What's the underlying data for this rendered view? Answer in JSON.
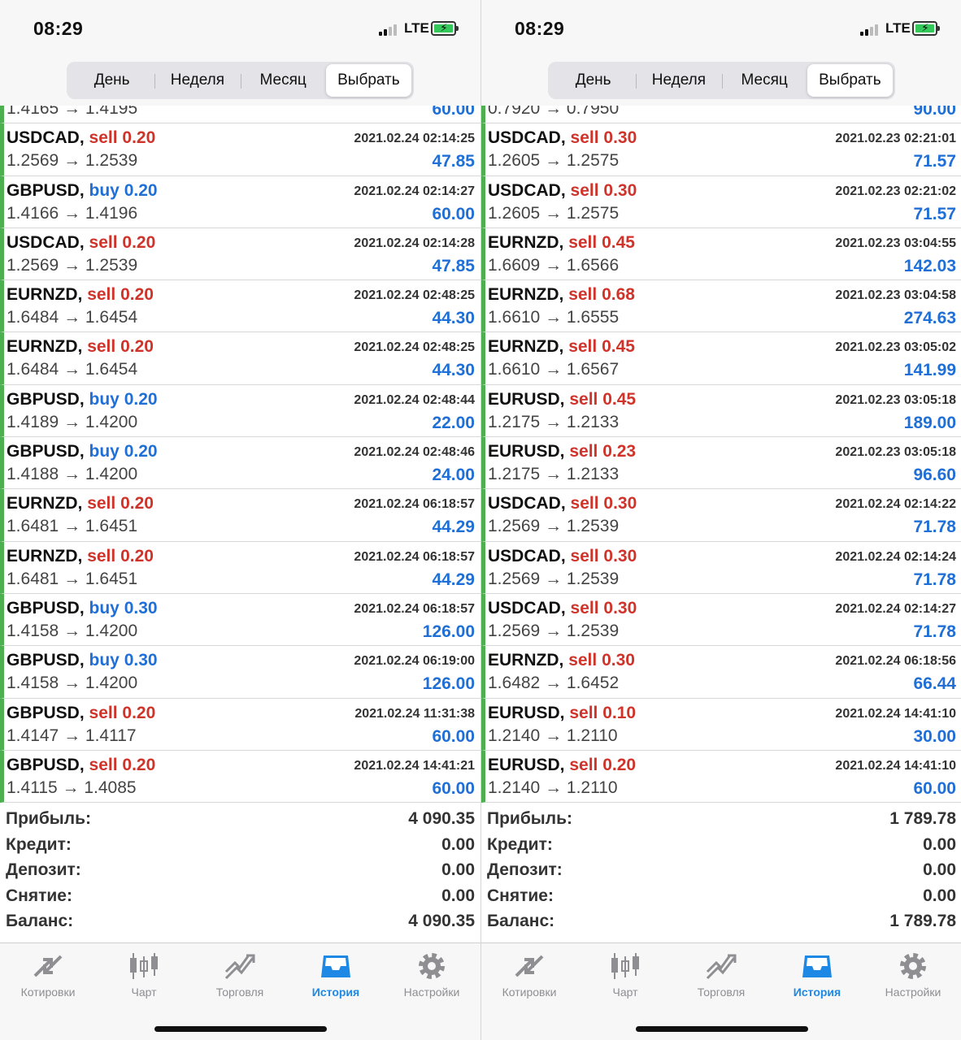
{
  "status_bar": {
    "time": "08:29",
    "network": "LTE"
  },
  "segments": [
    "День",
    "Неделя",
    "Месяц",
    "Выбрать"
  ],
  "active_segment": "Выбрать",
  "tabs": [
    "Котировки",
    "Чарт",
    "Торговля",
    "История",
    "Настройки"
  ],
  "active_tab": "История",
  "colors": {
    "sell": "#d0332a",
    "buy": "#1f6fd6",
    "profit": "#1f6fd6",
    "accent_tab": "#1e88e5",
    "closed_marker": "#4caf50"
  },
  "panels": [
    {
      "clipped_row": {
        "prices": "1.4165 → 1.4195",
        "profit": "60.00"
      },
      "trades": [
        {
          "symbol": "USDCAD,",
          "side": "sell",
          "volume": "0.20",
          "datetime": "2021.02.24 02:14:25",
          "prices": "1.2569 → 1.2539",
          "profit": "47.85"
        },
        {
          "symbol": "GBPUSD,",
          "side": "buy",
          "volume": "0.20",
          "datetime": "2021.02.24 02:14:27",
          "prices": "1.4166 → 1.4196",
          "profit": "60.00"
        },
        {
          "symbol": "USDCAD,",
          "side": "sell",
          "volume": "0.20",
          "datetime": "2021.02.24 02:14:28",
          "prices": "1.2569 → 1.2539",
          "profit": "47.85"
        },
        {
          "symbol": "EURNZD,",
          "side": "sell",
          "volume": "0.20",
          "datetime": "2021.02.24 02:48:25",
          "prices": "1.6484 → 1.6454",
          "profit": "44.30"
        },
        {
          "symbol": "EURNZD,",
          "side": "sell",
          "volume": "0.20",
          "datetime": "2021.02.24 02:48:25",
          "prices": "1.6484 → 1.6454",
          "profit": "44.30"
        },
        {
          "symbol": "GBPUSD,",
          "side": "buy",
          "volume": "0.20",
          "datetime": "2021.02.24 02:48:44",
          "prices": "1.4189 → 1.4200",
          "profit": "22.00"
        },
        {
          "symbol": "GBPUSD,",
          "side": "buy",
          "volume": "0.20",
          "datetime": "2021.02.24 02:48:46",
          "prices": "1.4188 → 1.4200",
          "profit": "24.00"
        },
        {
          "symbol": "EURNZD,",
          "side": "sell",
          "volume": "0.20",
          "datetime": "2021.02.24 06:18:57",
          "prices": "1.6481 → 1.6451",
          "profit": "44.29"
        },
        {
          "symbol": "EURNZD,",
          "side": "sell",
          "volume": "0.20",
          "datetime": "2021.02.24 06:18:57",
          "prices": "1.6481 → 1.6451",
          "profit": "44.29"
        },
        {
          "symbol": "GBPUSD,",
          "side": "buy",
          "volume": "0.30",
          "datetime": "2021.02.24 06:18:57",
          "prices": "1.4158 → 1.4200",
          "profit": "126.00"
        },
        {
          "symbol": "GBPUSD,",
          "side": "buy",
          "volume": "0.30",
          "datetime": "2021.02.24 06:19:00",
          "prices": "1.4158 → 1.4200",
          "profit": "126.00"
        },
        {
          "symbol": "GBPUSD,",
          "side": "sell",
          "volume": "0.20",
          "datetime": "2021.02.24 11:31:38",
          "prices": "1.4147 → 1.4117",
          "profit": "60.00"
        },
        {
          "symbol": "GBPUSD,",
          "side": "sell",
          "volume": "0.20",
          "datetime": "2021.02.24 14:41:21",
          "prices": "1.4115 → 1.4085",
          "profit": "60.00"
        }
      ],
      "summary": [
        {
          "label": "Прибыль:",
          "value": "4 090.35"
        },
        {
          "label": "Кредит:",
          "value": "0.00"
        },
        {
          "label": "Депозит:",
          "value": "0.00"
        },
        {
          "label": "Снятие:",
          "value": "0.00"
        },
        {
          "label": "Баланс:",
          "value": "4 090.35"
        }
      ]
    },
    {
      "clipped_row": {
        "prices": "0.7920 → 0.7950",
        "profit": "90.00"
      },
      "trades": [
        {
          "symbol": "USDCAD,",
          "side": "sell",
          "volume": "0.30",
          "datetime": "2021.02.23 02:21:01",
          "prices": "1.2605 → 1.2575",
          "profit": "71.57"
        },
        {
          "symbol": "USDCAD,",
          "side": "sell",
          "volume": "0.30",
          "datetime": "2021.02.23 02:21:02",
          "prices": "1.2605 → 1.2575",
          "profit": "71.57"
        },
        {
          "symbol": "EURNZD,",
          "side": "sell",
          "volume": "0.45",
          "datetime": "2021.02.23 03:04:55",
          "prices": "1.6609 → 1.6566",
          "profit": "142.03"
        },
        {
          "symbol": "EURNZD,",
          "side": "sell",
          "volume": "0.68",
          "datetime": "2021.02.23 03:04:58",
          "prices": "1.6610 → 1.6555",
          "profit": "274.63"
        },
        {
          "symbol": "EURNZD,",
          "side": "sell",
          "volume": "0.45",
          "datetime": "2021.02.23 03:05:02",
          "prices": "1.6610 → 1.6567",
          "profit": "141.99"
        },
        {
          "symbol": "EURUSD,",
          "side": "sell",
          "volume": "0.45",
          "datetime": "2021.02.23 03:05:18",
          "prices": "1.2175 → 1.2133",
          "profit": "189.00"
        },
        {
          "symbol": "EURUSD,",
          "side": "sell",
          "volume": "0.23",
          "datetime": "2021.02.23 03:05:18",
          "prices": "1.2175 → 1.2133",
          "profit": "96.60"
        },
        {
          "symbol": "USDCAD,",
          "side": "sell",
          "volume": "0.30",
          "datetime": "2021.02.24 02:14:22",
          "prices": "1.2569 → 1.2539",
          "profit": "71.78"
        },
        {
          "symbol": "USDCAD,",
          "side": "sell",
          "volume": "0.30",
          "datetime": "2021.02.24 02:14:24",
          "prices": "1.2569 → 1.2539",
          "profit": "71.78"
        },
        {
          "symbol": "USDCAD,",
          "side": "sell",
          "volume": "0.30",
          "datetime": "2021.02.24 02:14:27",
          "prices": "1.2569 → 1.2539",
          "profit": "71.78"
        },
        {
          "symbol": "EURNZD,",
          "side": "sell",
          "volume": "0.30",
          "datetime": "2021.02.24 06:18:56",
          "prices": "1.6482 → 1.6452",
          "profit": "66.44"
        },
        {
          "symbol": "EURUSD,",
          "side": "sell",
          "volume": "0.10",
          "datetime": "2021.02.24 14:41:10",
          "prices": "1.2140 → 1.2110",
          "profit": "30.00"
        },
        {
          "symbol": "EURUSD,",
          "side": "sell",
          "volume": "0.20",
          "datetime": "2021.02.24 14:41:10",
          "prices": "1.2140 → 1.2110",
          "profit": "60.00"
        }
      ],
      "summary": [
        {
          "label": "Прибыль:",
          "value": "1 789.78"
        },
        {
          "label": "Кредит:",
          "value": "0.00"
        },
        {
          "label": "Депозит:",
          "value": "0.00"
        },
        {
          "label": "Снятие:",
          "value": "0.00"
        },
        {
          "label": "Баланс:",
          "value": "1 789.78"
        }
      ]
    }
  ]
}
